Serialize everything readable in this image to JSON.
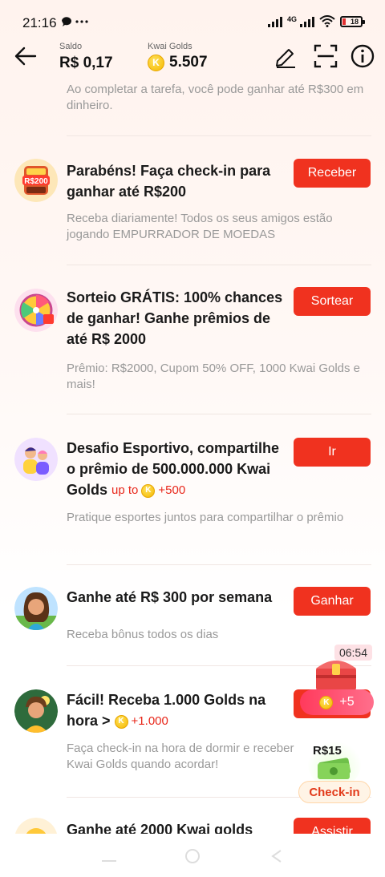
{
  "status_bar": {
    "time": "21:16",
    "left_icons": "● •••",
    "network": "4G",
    "battery": "18"
  },
  "header": {
    "saldo_label": "Saldo",
    "saldo_value": "R$ 0,17",
    "golds_label": "Kwai Golds",
    "golds_value": "5.507",
    "coin_letter": "K"
  },
  "tasks": [
    {
      "title": "",
      "desc": "Ao completar a tarefa, você pode ganhar até R$300 em dinheiro.",
      "button": ""
    },
    {
      "title": "Parabéns! Faça check-in para ganhar até R$200",
      "desc": "Receba diariamente! Todos os seus amigos estão jogando EMPURRADOR DE MOEDAS",
      "button": "Receber",
      "thumb_text": "R$200"
    },
    {
      "title": "Sorteio GRÁTIS: 100% chances de ganhar! Ganhe prêmios de até R$ 2000",
      "desc": "Prêmio: R$2000, Cupom 50% OFF, 1000 Kwai Golds e mais!",
      "button": "Sortear"
    },
    {
      "title": "Desafio Esportivo, compartilhe o prêmio de 500.000.000 Kwai Golds",
      "reward_prefix": "up to",
      "reward": "+500",
      "desc": "Pratique esportes juntos para compartilhar o prêmio",
      "button": "Ir"
    },
    {
      "title": "Ganhe até R$ 300 por semana",
      "desc": "Receba bônus todos os dias",
      "button": "Ganhar"
    },
    {
      "title": "Fácil! Receba 1.000 Golds na hora >",
      "reward": "+1.000",
      "desc": "Faça check-in na hora de dormir e receber Kwai Golds quando acordar!",
      "button": ""
    },
    {
      "title": "Ganhe até 2000 Kwai golds",
      "desc": "",
      "button": "Assistir"
    }
  ],
  "floating": {
    "timer": "06:54",
    "chest_reward": "+5",
    "checkin_amount": "R$15",
    "checkin_label": "Check-in"
  },
  "colors": {
    "accent": "#f0321f",
    "reward": "#e8271a",
    "coin": "#f5b800"
  }
}
